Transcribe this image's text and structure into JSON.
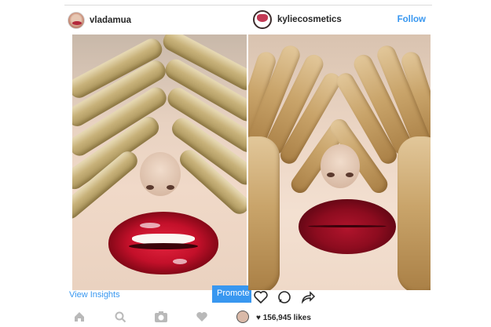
{
  "left_post": {
    "username": "vladamua",
    "avatar_icon": "avatar-lips",
    "insights_label": "View Insights",
    "promote_label": "Promote"
  },
  "right_post": {
    "username": "kyliecosmetics",
    "avatar_icon": "avatar-lip-drip",
    "follow_label": "Follow",
    "likes_label": "156,945 likes"
  },
  "bottom_nav": {
    "icons": [
      "home-icon",
      "search-icon",
      "camera-icon",
      "heart-icon",
      "profile-icon"
    ]
  },
  "actions": {
    "icons": [
      "heart-outline-icon",
      "comment-icon",
      "share-icon"
    ]
  },
  "colors": {
    "link_blue": "#3897f0",
    "text": "#262626",
    "gold": "#c8b27a",
    "lip_red": "#c3102a",
    "lip_matte": "#8d0c1f"
  }
}
